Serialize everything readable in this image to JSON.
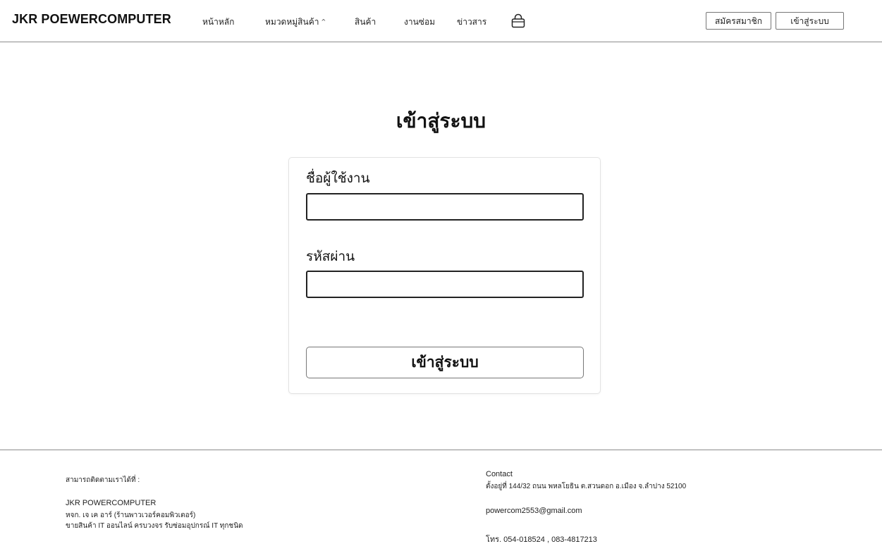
{
  "header": {
    "brand": "JKR POEWERCOMPUTER",
    "nav": [
      "หน้าหลัก",
      "หมวดหมู่สินค้า",
      "สินค้า",
      "งานซ่อม",
      "ข่าวสาร"
    ],
    "categories_caret": "^",
    "cart_icon": "shopping-bag-icon",
    "register_label": "สมัครสมาชิก",
    "login_label": "เข้าสู่ระบบ"
  },
  "login": {
    "title": "เข้าสู่ระบบ",
    "username_label": "ชื่อผู้ใช้งาน",
    "username_value": "",
    "password_label": "รหัสผ่าน",
    "password_value": "",
    "submit_label": "เข้าสู่ระบบ"
  },
  "footer": {
    "follow_label": "สามารถติดตามเราได้ที่ :",
    "company": "JKR POWERCOMPUTER",
    "company_legal": "หจก. เจ เค อาร์ (ร้านพาวเวอร์คอมพิวเตอร์)",
    "tagline": "ขายสินค้า IT ออนไลน์ ครบวงจร รับซ่อมอุปกรณ์ IT ทุกชนิด",
    "contact_heading": "Contact",
    "address": "ตั้งอยู่ที่ 144/32 ถนน พหลโยธิน ต.สวนดอก อ.เมือง จ.ลำปาง 52100",
    "email": "powercom2553@gmail.com",
    "phone": "โทร. 054-018524 , 083-4817213"
  }
}
